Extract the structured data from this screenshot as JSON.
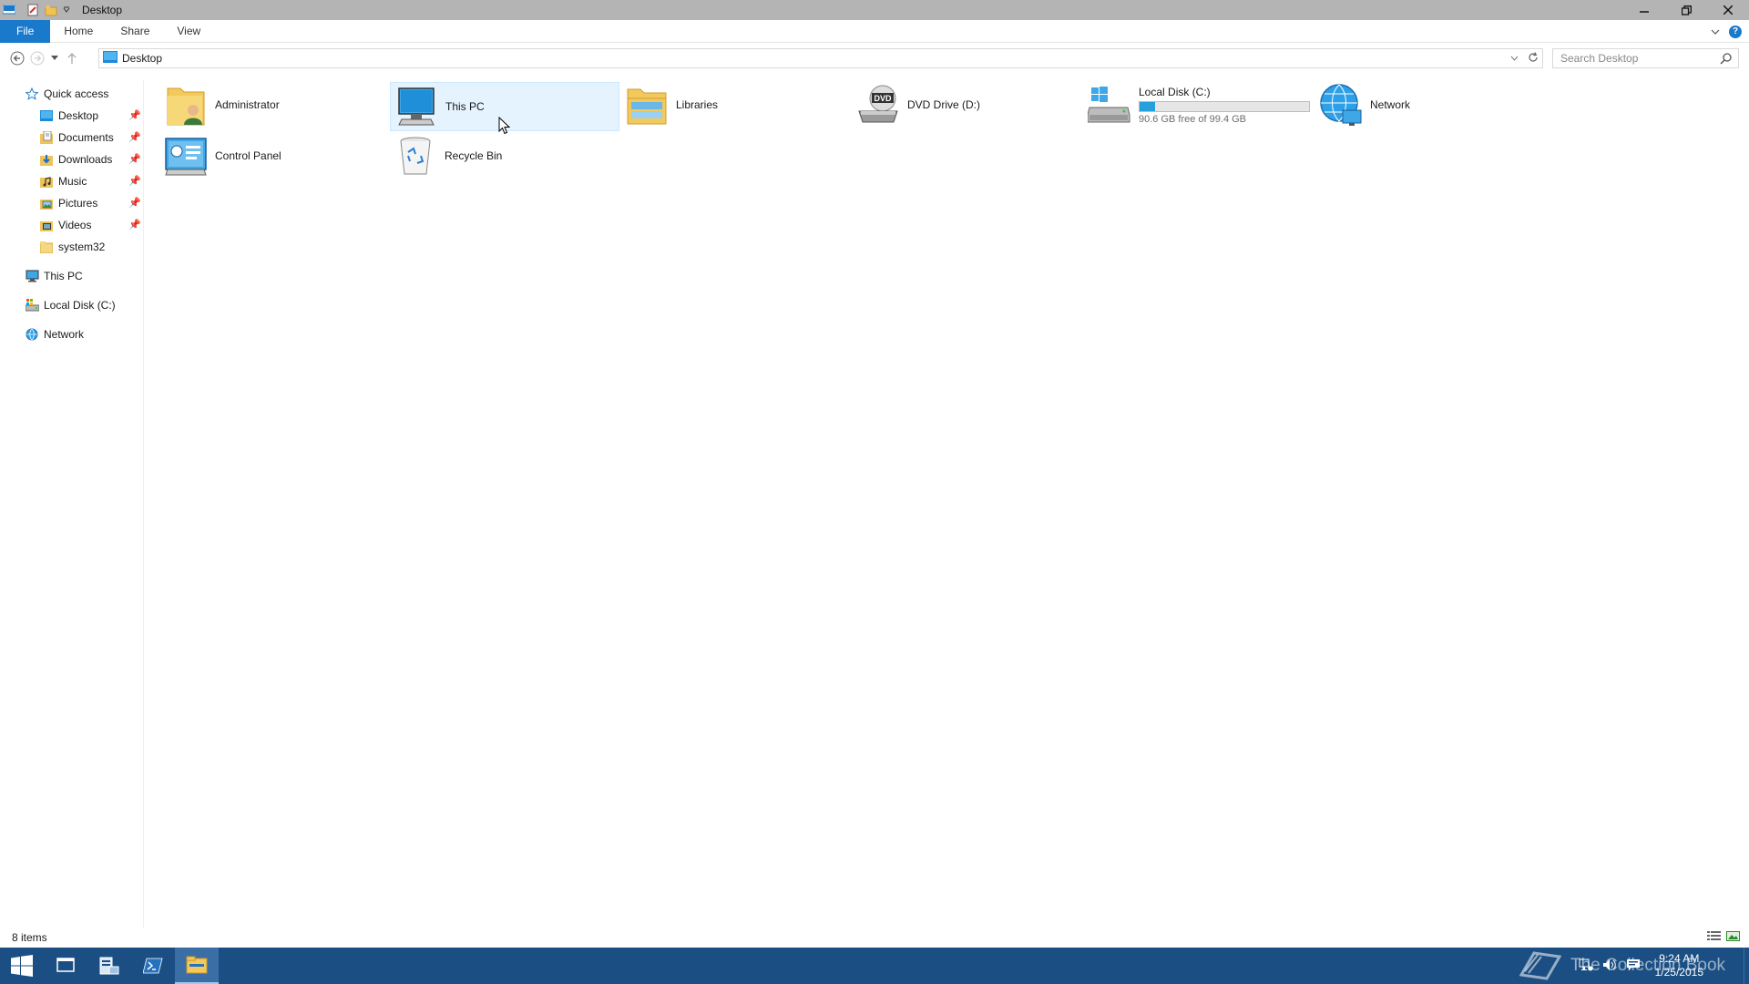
{
  "window": {
    "title": "Desktop"
  },
  "ribbon": {
    "tabs": [
      "File",
      "Home",
      "Share",
      "View"
    ]
  },
  "navbar": {
    "address": "Desktop",
    "search_placeholder": "Search Desktop"
  },
  "sidebar": {
    "quick_access": "Quick access",
    "pinned": [
      "Desktop",
      "Documents",
      "Downloads",
      "Music",
      "Pictures",
      "Videos"
    ],
    "recent": "system32",
    "this_pc": "This PC",
    "local_disk": "Local Disk (C:)",
    "network": "Network"
  },
  "content": {
    "items": [
      {
        "label": "Administrator",
        "icon": "user-folder-icon"
      },
      {
        "label": "This PC",
        "icon": "computer-icon",
        "selected": true
      },
      {
        "label": "Libraries",
        "icon": "libraries-icon"
      },
      {
        "label": "DVD Drive (D:)",
        "icon": "dvd-drive-icon"
      },
      {
        "label": "Local Disk (C:)",
        "icon": "hard-disk-icon",
        "free_text": "90.6 GB free of 99.4 GB",
        "used_fraction": 0.089
      },
      {
        "label": "Network",
        "icon": "network-icon"
      },
      {
        "label": "Control Panel",
        "icon": "control-panel-icon"
      },
      {
        "label": "Recycle Bin",
        "icon": "recycle-bin-icon"
      }
    ]
  },
  "status": {
    "count": "8 items"
  },
  "taskbar": {
    "watermark": "The Collection Book",
    "time": "9:24 AM",
    "date": "1/25/2015"
  },
  "colors": {
    "accent": "#1979ca",
    "taskbar": "#1b4f83",
    "selection": "#e5f3ff",
    "titlebar": "#b4b4b4"
  }
}
